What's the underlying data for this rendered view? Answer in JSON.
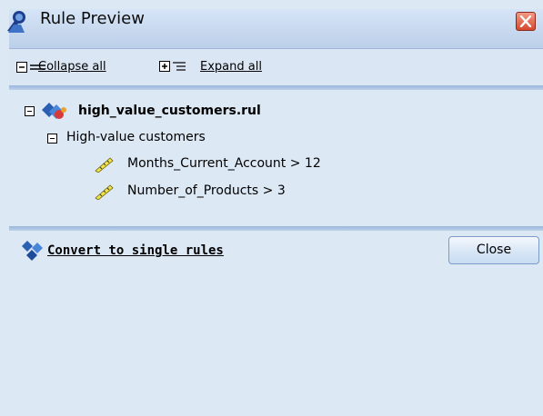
{
  "window": {
    "title": "Rule Preview",
    "title_icon": "rule-preview-icon",
    "close_icon": "close-x-icon"
  },
  "toolbar": {
    "collapse_label": "Collapse all",
    "expand_label": "Expand all",
    "collapse_icon": "collapse-all-icon",
    "expand_icon": "expand-all-icon"
  },
  "tree": {
    "root": {
      "label": "high_value_customers.rul",
      "icon": "ruleset-icon",
      "expanded": true
    },
    "group": {
      "label": "High-value customers",
      "expanded": true
    },
    "conditions": [
      {
        "label": "Months_Current_Account > 12",
        "icon": "condition-ruler-icon"
      },
      {
        "label": "Number_of_Products > 3",
        "icon": "condition-ruler-icon"
      }
    ]
  },
  "footer": {
    "convert_label": "Convert to single rules",
    "convert_icon": "convert-rules-icon",
    "close_label": "Close"
  },
  "colors": {
    "background": "#dde8f5",
    "titlebar": "#c9daf0",
    "close_red": "#d54a2e"
  }
}
